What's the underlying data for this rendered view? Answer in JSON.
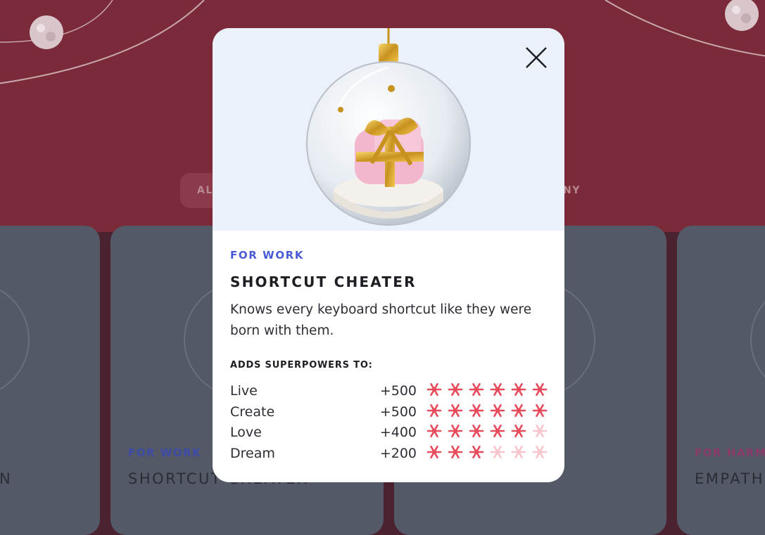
{
  "background": {
    "filter_left_label": "AL",
    "filter_right_label": "NY",
    "cards": [
      {
        "category": "",
        "name": "ON"
      },
      {
        "category": "FOR WORK",
        "name": "SHORTCUT CHEATER"
      },
      {
        "category": "",
        "name": ""
      },
      {
        "category": "FOR HARMO",
        "name": "EMPATH"
      }
    ]
  },
  "modal": {
    "category": "FOR WORK",
    "title": "SHORTCUT CHEATER",
    "description": "Knows every keyboard shortcut like they were born with them.",
    "powers_heading": "ADDS SUPERPOWERS TO:",
    "stats": [
      {
        "label": "Live",
        "value": "+500",
        "level": 6
      },
      {
        "label": "Create",
        "value": "+500",
        "level": 6
      },
      {
        "label": "Love",
        "value": "+400",
        "level": 5
      },
      {
        "label": "Dream",
        "value": "+200",
        "level": 3
      }
    ],
    "max_level": 6
  },
  "icons": {
    "close": "close-icon",
    "rating": "snowflake-icon",
    "hero": "christmas-ornament-gift-icon"
  },
  "colors": {
    "category_accent": "#4a5bd6",
    "flake_active": "#e84b5c",
    "flake_inactive": "#f7c5cb",
    "background_red": "#7a2a38"
  }
}
